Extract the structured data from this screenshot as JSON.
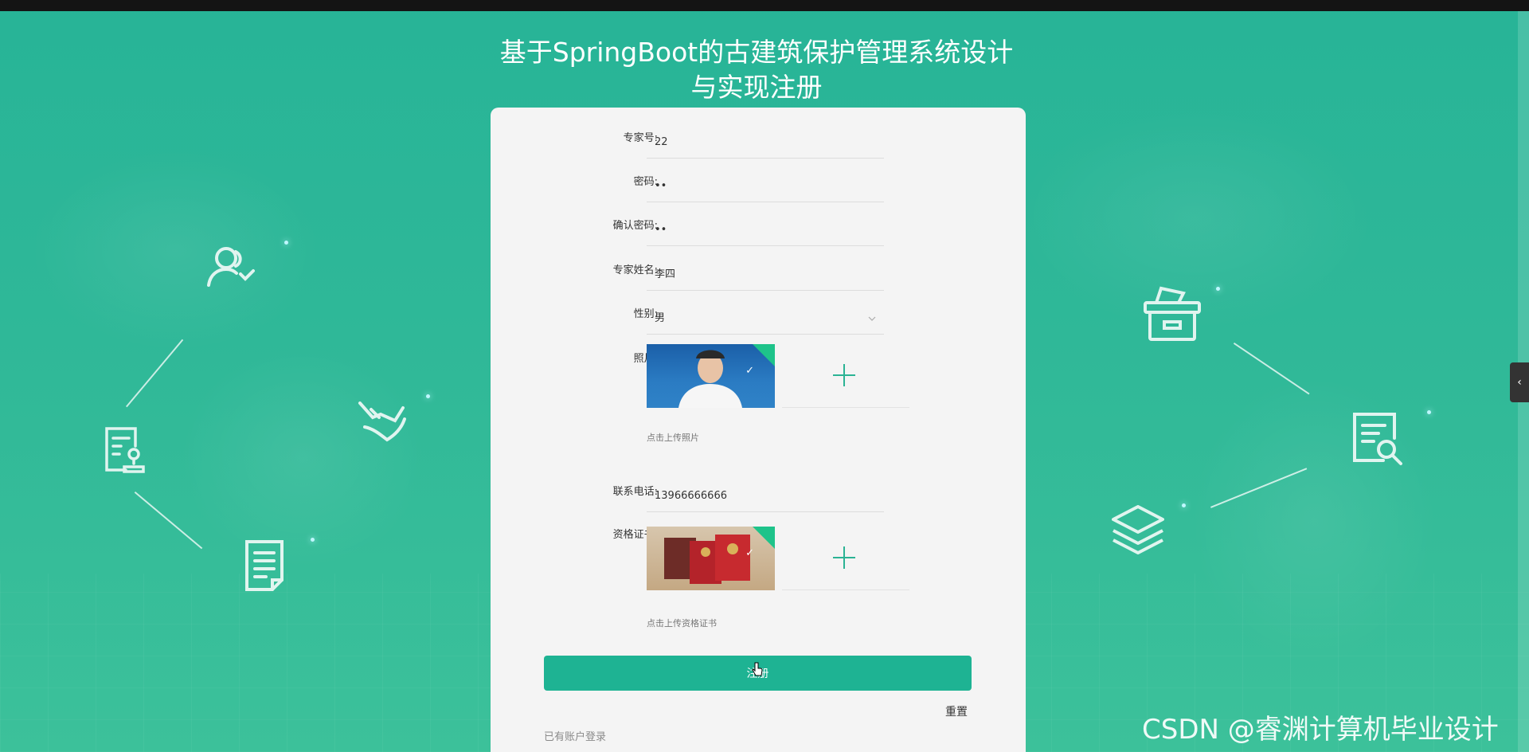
{
  "page": {
    "title": "基于SpringBoot的古建筑保护管理系统设计与实现注册",
    "title_line1": "基于SpringBoot的古建筑保护管理系统设计",
    "title_line2": "与实现注册"
  },
  "form": {
    "expert_no": {
      "label": "专家号:",
      "value": "22"
    },
    "password": {
      "label": "密码:",
      "value": "••"
    },
    "confirm_password": {
      "label": "确认密码:",
      "value": "••"
    },
    "expert_name": {
      "label": "专家姓名:",
      "value": "李四"
    },
    "gender": {
      "label": "性别:",
      "value": "男"
    },
    "photo": {
      "label": "照片:",
      "hint": "点击上传照片"
    },
    "phone": {
      "label": "联系电话:",
      "value": "13966666666"
    },
    "certificate": {
      "label": "资格证书:",
      "hint": "点击上传资格证书"
    }
  },
  "actions": {
    "register": "注册",
    "reset": "重置",
    "login_link": "已有账户登录"
  },
  "watermark": "CSDN @睿渊计算机毕业设计",
  "side_tab": "‹",
  "colors": {
    "accent": "#1eb393",
    "background": "#2fb898",
    "card": "#f4f4f4"
  },
  "icons": [
    "users-icon",
    "document-stamp-icon",
    "hand-heart-icon",
    "document-icon",
    "archive-box-icon",
    "document-search-icon",
    "layers-icon",
    "plus-icon",
    "check-icon",
    "chevron-down-icon"
  ]
}
